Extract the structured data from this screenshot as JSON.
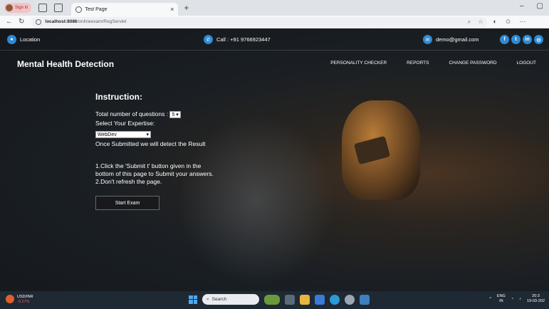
{
  "browser": {
    "profile_label": "Sign in",
    "tab_title": "Test Page",
    "url_host": "localhost:8086",
    "url_path": "/onlineexam/RegServlet"
  },
  "infobar": {
    "location": "Location",
    "call": "Call : +91 9766923447",
    "email": "demo@gmail.com"
  },
  "site": {
    "brand": "Mental Health Detection",
    "menu": [
      "PERSONALITY CHECKER",
      "REPORTS",
      "CHANGE PASSWORD",
      "LOGOUT"
    ]
  },
  "instructions": {
    "heading": "Instruction:",
    "total_label": "Total number of questions :",
    "total_value": "5",
    "expertise_label": "Select Your Expertise:",
    "expertise_value": "WebDev",
    "once_submitted": "Once Submitted we will detect the Result",
    "rule1": "1.Click the 'Submit t' button given in the bottom of this page to Submit your answers.",
    "rule2": "2.Don't refresh the page.",
    "start_button": "Start Exam"
  },
  "taskbar": {
    "ticker": "USD/INR",
    "ticker_change": "-0.27%",
    "search_placeholder": "Search",
    "lang": "ENG",
    "region": "IN",
    "time": "20:3",
    "date": "19-03-202"
  }
}
